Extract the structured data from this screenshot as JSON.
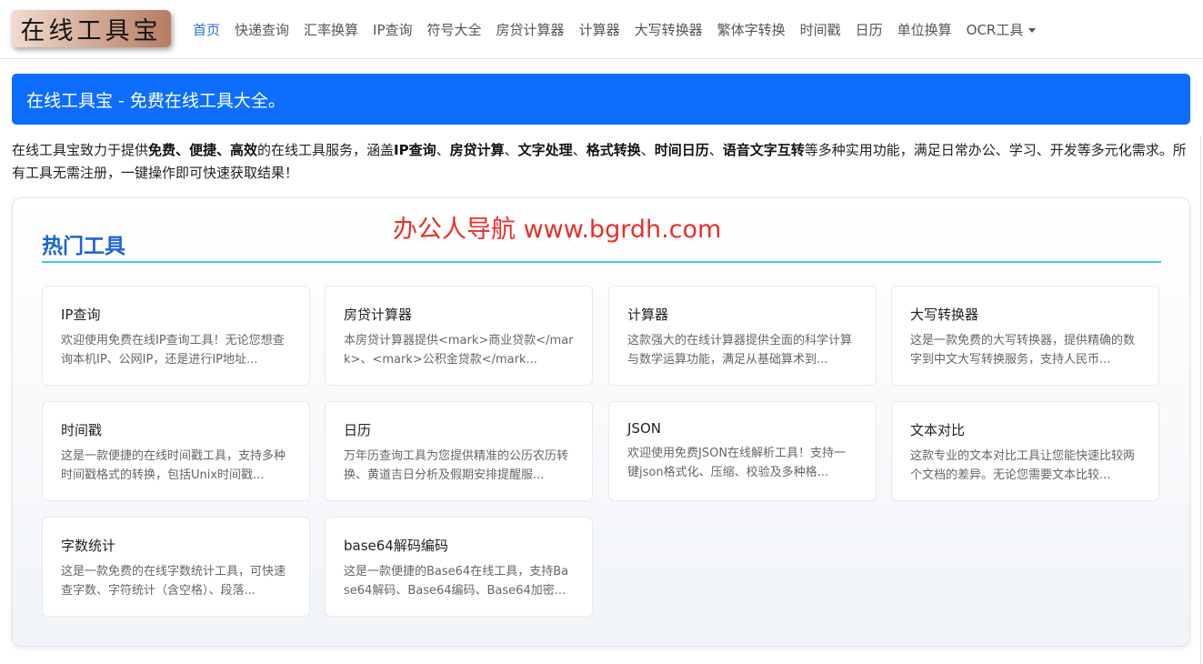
{
  "header": {
    "logo_text": "在线工具宝",
    "nav": [
      {
        "label": "首页",
        "active": true
      },
      {
        "label": "快递查询"
      },
      {
        "label": "汇率换算"
      },
      {
        "label": "IP查询"
      },
      {
        "label": "符号大全"
      },
      {
        "label": "房贷计算器"
      },
      {
        "label": "计算器"
      },
      {
        "label": "大写转换器"
      },
      {
        "label": "繁体字转换"
      },
      {
        "label": "时间戳"
      },
      {
        "label": "日历"
      },
      {
        "label": "单位换算"
      },
      {
        "label": "OCR工具",
        "dropdown": true
      }
    ]
  },
  "banner": {
    "text": "在线工具宝 - 免费在线工具大全。",
    "color": "#0d6efd"
  },
  "intro": {
    "p1": "在线工具宝致力于提供",
    "b1": "免费、便捷、高效",
    "p2": "的在线工具服务，涵盖",
    "b2": "IP查询",
    "p3": "、",
    "b3": "房贷计算",
    "p4": "、",
    "b4": "文字处理",
    "p5": "、",
    "b5": "格式转换",
    "p6": "、",
    "b6": "时间日历",
    "p7": "、",
    "b7": "语音文字互转",
    "p8": "等多种实用功能，满足日常办公、学习、开发等多元化需求。所有工具无需注册，一键操作即可快速获取结果！"
  },
  "hot": {
    "title": "热门工具",
    "watermark": "办公人导航 www.bgrdh.com",
    "cards": [
      {
        "title": "IP查询",
        "desc": "欢迎使用免费在线IP查询工具！无论您想查询本机IP、公网IP，还是进行IP地址..."
      },
      {
        "title": "房贷计算器",
        "desc": "本房贷计算器提供<mark>商业贷款</mark>、<mark>公积金贷款</mark..."
      },
      {
        "title": "计算器",
        "desc": "这款强大的在线计算器提供全面的科学计算与数学运算功能，满足从基础算术到..."
      },
      {
        "title": "大写转换器",
        "desc": "这是一款免费的大写转换器，提供精确的数字到中文大写转换服务，支持人民币..."
      },
      {
        "title": "时间戳",
        "desc": "这是一款便捷的在线时间戳工具，支持多种时间戳格式的转换，包括Unix时间戳..."
      },
      {
        "title": "日历",
        "desc": "万年历查询工具为您提供精准的公历农历转换、黄道吉日分析及假期安排提醒服..."
      },
      {
        "title": "JSON",
        "desc": "欢迎使用免费JSON在线解析工具！支持一键json格式化、压缩、校验及多种格..."
      },
      {
        "title": "文本对比",
        "desc": "这款专业的文本对比工具让您能快速比较两个文档的差异。无论您需要文本比较..."
      },
      {
        "title": "字数统计",
        "desc": "这是一款免费的在线字数统计工具，可快速查字数、字符统计（含空格）、段落..."
      },
      {
        "title": "base64解码编码",
        "desc": "这是一款便捷的Base64在线工具，支持Base64解码、Base64编码、Base64加密..."
      }
    ]
  }
}
